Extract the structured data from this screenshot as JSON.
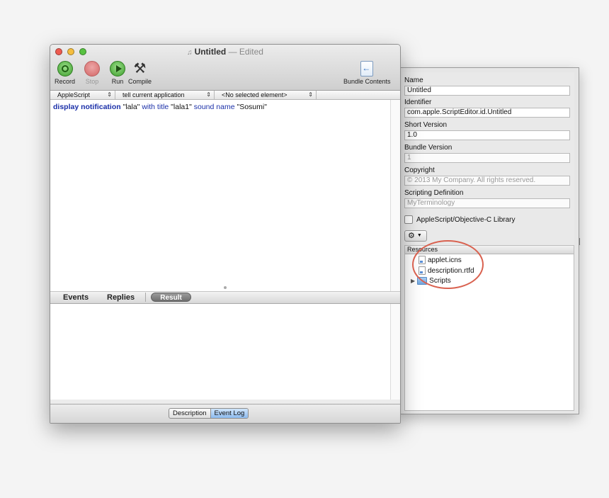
{
  "window": {
    "title": "Untitled",
    "title_suffix": "— Edited",
    "doc_icon": "script-document-icon"
  },
  "toolbar": {
    "record_label": "Record",
    "stop_label": "Stop",
    "run_label": "Run",
    "compile_label": "Compile",
    "bundle_label": "Bundle Contents"
  },
  "navbar": {
    "language": "AppleScript",
    "target": "tell current application",
    "element": "<No selected element>"
  },
  "editor": {
    "kw1": "display notification",
    "s1": " \"lala\" ",
    "kw2": "with title",
    "s2": " \"lala1\" ",
    "kw3": "sound name",
    "s3": " \"Sosumi\""
  },
  "log_tabs": {
    "events": "Events",
    "replies": "Replies",
    "result": "Result",
    "selected": "Result"
  },
  "bottom_segments": {
    "description": "Description",
    "event_log": "Event Log",
    "selected": "Event Log"
  },
  "bundle": {
    "name_label": "Name",
    "name_value": "Untitled",
    "identifier_label": "Identifier",
    "identifier_value": "com.apple.ScriptEditor.id.Untitled",
    "short_version_label": "Short Version",
    "short_version_value": "1.0",
    "bundle_version_label": "Bundle Version",
    "bundle_version_placeholder": "1",
    "copyright_label": "Copyright",
    "copyright_placeholder": "© 2013 My Company. All rights reserved.",
    "scripting_def_label": "Scripting Definition",
    "scripting_def_placeholder": "MyTerminology",
    "library_checkbox_label": "AppleScript/Objective-C Library",
    "library_checked": false,
    "action_menu_icon": "gear-icon",
    "resources_header": "Resources",
    "resources": [
      {
        "name": "applet.icns",
        "kind": "file"
      },
      {
        "name": "description.rtfd",
        "kind": "file"
      },
      {
        "name": "Scripts",
        "kind": "folder"
      }
    ]
  },
  "colors": {
    "annotation_circle": "#d9614f",
    "keyword_blue": "#1a2fa8"
  }
}
